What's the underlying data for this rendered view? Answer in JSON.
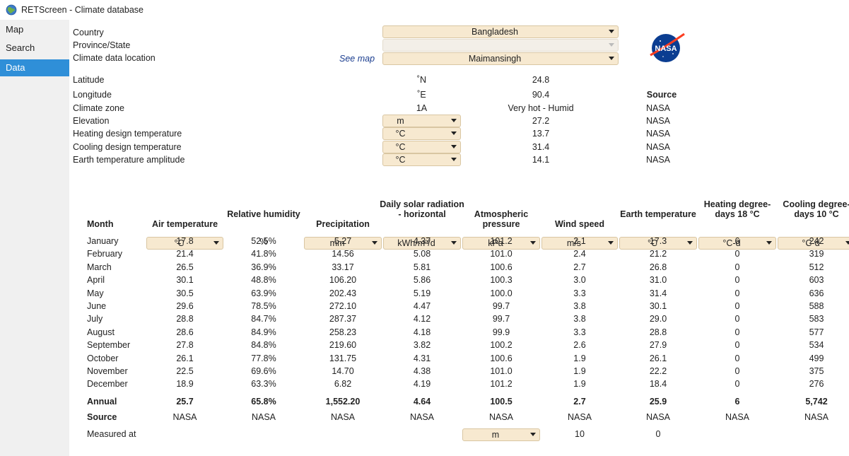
{
  "window": {
    "title": "RETScreen - Climate database",
    "icon": "globe-icon"
  },
  "sidebar": {
    "items": [
      {
        "label": "Map",
        "active": false
      },
      {
        "label": "Search",
        "active": false
      },
      {
        "label": "Data",
        "active": true
      }
    ]
  },
  "location": {
    "country_label": "Country",
    "country_value": "Bangladesh",
    "province_label": "Province/State",
    "province_value": "",
    "location_label": "Climate data location",
    "see_map": "See map",
    "location_value": "Maimansingh",
    "logo": "NASA"
  },
  "info": {
    "source_header": "Source",
    "rows": [
      {
        "label": "Latitude",
        "unit": "˚N",
        "value": "24.8",
        "source": ""
      },
      {
        "label": "Longitude",
        "unit": "˚E",
        "value": "90.4",
        "source": ""
      },
      {
        "label": "Climate zone",
        "unit": "1A",
        "value": "Very hot - Humid",
        "source": "NASA"
      },
      {
        "label": "Elevation",
        "unit": "m",
        "value": "27.2",
        "source": "NASA"
      },
      {
        "label": "Heating design temperature",
        "unit": "°C",
        "value": "13.7",
        "source": "NASA"
      },
      {
        "label": "Cooling design temperature",
        "unit": "°C",
        "value": "31.4",
        "source": "NASA"
      },
      {
        "label": "Earth temperature amplitude",
        "unit": "°C",
        "value": "14.1",
        "source": "NASA"
      }
    ]
  },
  "table": {
    "month_header": "Month",
    "columns": [
      {
        "header": "Air temperature",
        "unit": "°C"
      },
      {
        "header": "Relative humidity",
        "unit": "%"
      },
      {
        "header": "Precipitation",
        "unit": "mm"
      },
      {
        "header": "Daily solar radiation - horizontal",
        "unit": "kWh/m²/d"
      },
      {
        "header": "Atmospheric pressure",
        "unit": "kPa"
      },
      {
        "header": "Wind speed",
        "unit": "m/s"
      },
      {
        "header": "Earth temperature",
        "unit": "°C"
      },
      {
        "header": "Heating degree-days 18 °C",
        "unit": "°C-d"
      },
      {
        "header": "Cooling degree-days 10 °C",
        "unit": "°C-d"
      }
    ],
    "rows": [
      {
        "month": "January",
        "values": [
          "17.8",
          "52.5%",
          "5.27",
          "4.37",
          "101.2",
          "2.1",
          "17.3",
          "6",
          "242"
        ]
      },
      {
        "month": "February",
        "values": [
          "21.4",
          "41.8%",
          "14.56",
          "5.08",
          "101.0",
          "2.4",
          "21.2",
          "0",
          "319"
        ]
      },
      {
        "month": "March",
        "values": [
          "26.5",
          "36.9%",
          "33.17",
          "5.81",
          "100.6",
          "2.7",
          "26.8",
          "0",
          "512"
        ]
      },
      {
        "month": "April",
        "values": [
          "30.1",
          "48.8%",
          "106.20",
          "5.86",
          "100.3",
          "3.0",
          "31.0",
          "0",
          "603"
        ]
      },
      {
        "month": "May",
        "values": [
          "30.5",
          "63.9%",
          "202.43",
          "5.19",
          "100.0",
          "3.3",
          "31.4",
          "0",
          "636"
        ]
      },
      {
        "month": "June",
        "values": [
          "29.6",
          "78.5%",
          "272.10",
          "4.47",
          "99.7",
          "3.8",
          "30.1",
          "0",
          "588"
        ]
      },
      {
        "month": "July",
        "values": [
          "28.8",
          "84.7%",
          "287.37",
          "4.12",
          "99.7",
          "3.8",
          "29.0",
          "0",
          "583"
        ]
      },
      {
        "month": "August",
        "values": [
          "28.6",
          "84.9%",
          "258.23",
          "4.18",
          "99.9",
          "3.3",
          "28.8",
          "0",
          "577"
        ]
      },
      {
        "month": "September",
        "values": [
          "27.8",
          "84.8%",
          "219.60",
          "3.82",
          "100.2",
          "2.6",
          "27.9",
          "0",
          "534"
        ]
      },
      {
        "month": "October",
        "values": [
          "26.1",
          "77.8%",
          "131.75",
          "4.31",
          "100.6",
          "1.9",
          "26.1",
          "0",
          "499"
        ]
      },
      {
        "month": "November",
        "values": [
          "22.5",
          "69.6%",
          "14.70",
          "4.38",
          "101.0",
          "1.9",
          "22.2",
          "0",
          "375"
        ]
      },
      {
        "month": "December",
        "values": [
          "18.9",
          "63.3%",
          "6.82",
          "4.19",
          "101.2",
          "1.9",
          "18.4",
          "0",
          "276"
        ]
      }
    ],
    "annual": {
      "label": "Annual",
      "values": [
        "25.7",
        "65.8%",
        "1,552.20",
        "4.64",
        "100.5",
        "2.7",
        "25.9",
        "6",
        "5,742"
      ]
    },
    "source": {
      "label": "Source",
      "values": [
        "NASA",
        "NASA",
        "NASA",
        "NASA",
        "NASA",
        "NASA",
        "NASA",
        "NASA",
        "NASA"
      ]
    },
    "measured": {
      "label": "Measured at",
      "unit": "m",
      "wind": "10",
      "earth": "0"
    }
  }
}
